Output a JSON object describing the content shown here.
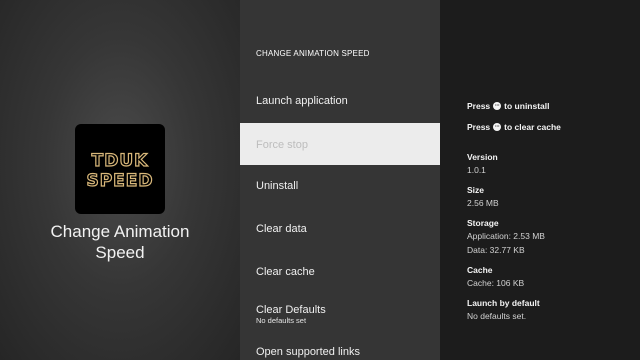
{
  "app": {
    "name": "Change Animation\nSpeed",
    "icon_text_line1": "TDUK",
    "icon_text_line2": "SPEED",
    "icon_name": "tduk-speed-app-icon"
  },
  "menu": {
    "title": "CHANGE ANIMATION SPEED",
    "items": [
      {
        "label": "Launch application"
      },
      {
        "label": "Force stop"
      },
      {
        "label": "Uninstall"
      },
      {
        "label": "Clear data"
      },
      {
        "label": "Clear cache"
      },
      {
        "label": "Clear Defaults",
        "sub": "No defaults set"
      },
      {
        "label": "Open supported links"
      }
    ]
  },
  "details": {
    "hint_uninstall_prefix": "Press",
    "hint_uninstall_suffix": "to uninstall",
    "hint_cache_prefix": "Press",
    "hint_cache_suffix": "to clear cache",
    "menu_button_glyph": "···",
    "version_label": "Version",
    "version_value": "1.0.1",
    "size_label": "Size",
    "size_value": "2.56 MB",
    "storage_label": "Storage",
    "storage_app": "Application: 2.53 MB",
    "storage_data": "Data: 32.77 KB",
    "cache_label": "Cache",
    "cache_value": "Cache: 106 KB",
    "launch_label": "Launch by default",
    "launch_value": "No defaults set."
  },
  "colors": {
    "left_bg": "#3c3c3c",
    "middle_bg": "#353535",
    "right_bg": "#1c1c1c",
    "selected_bg": "#ececec",
    "icon_outline": "#d9b87a"
  }
}
